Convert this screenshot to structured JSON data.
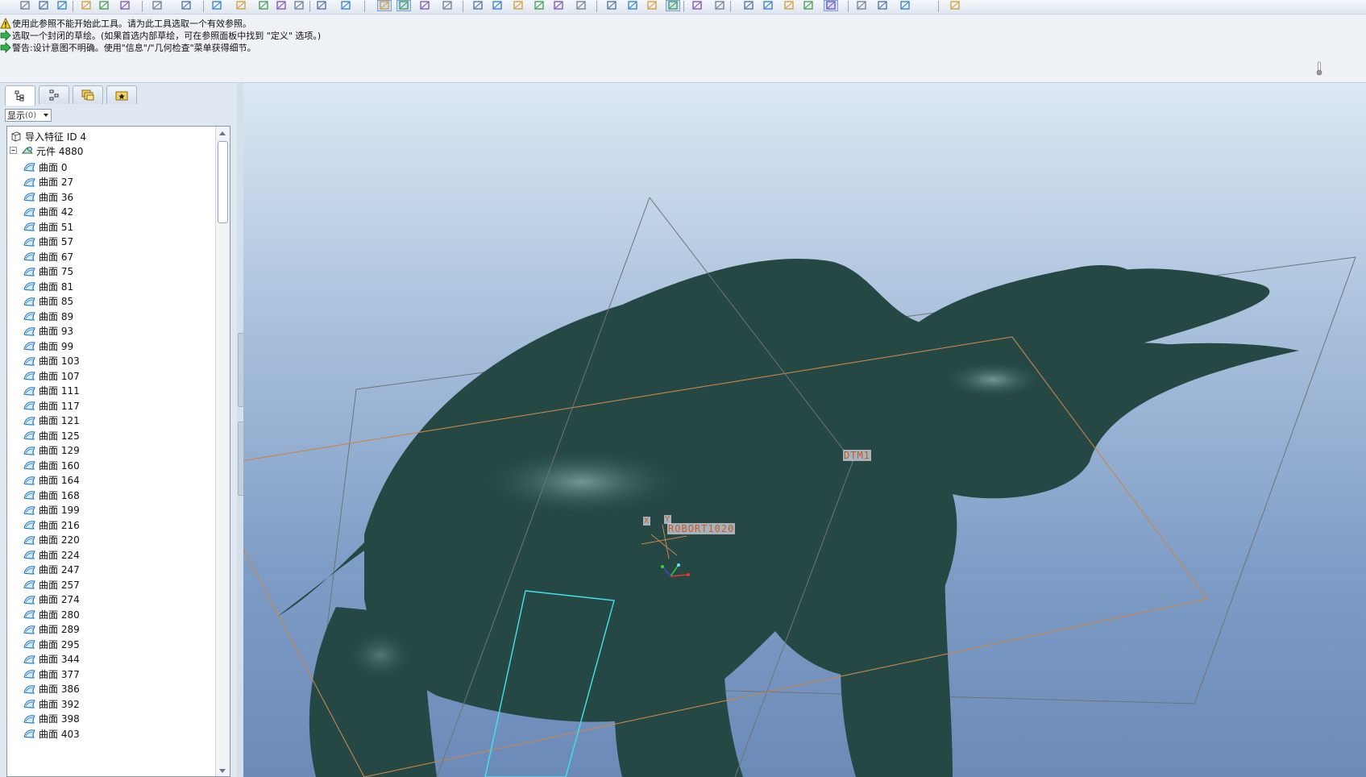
{
  "messages": [
    {
      "type": "warning",
      "text": "使用此参照不能开始此工具。请为此工具选取一个有效参照。"
    },
    {
      "type": "prompt",
      "text": "选取一个封闭的草绘。(如果首选内部草绘，可在参照面板中找到 \"定义\" 选项。)"
    },
    {
      "type": "prompt",
      "text": "警告:设计意图不明确。使用\"信息\"/\"几何检查\"菜单获得细节。"
    }
  ],
  "panel": {
    "show_label": "显示",
    "show_badge": "(0)",
    "tree": {
      "root_label": "导入特征 ID 4",
      "group_label": "元件 4880",
      "items": [
        "曲面 0",
        "曲面 27",
        "曲面 36",
        "曲面 42",
        "曲面 51",
        "曲面 57",
        "曲面 67",
        "曲面 75",
        "曲面 81",
        "曲面 85",
        "曲面 89",
        "曲面 93",
        "曲面 99",
        "曲面 103",
        "曲面 107",
        "曲面 111",
        "曲面 117",
        "曲面 121",
        "曲面 125",
        "曲面 129",
        "曲面 160",
        "曲面 164",
        "曲面 168",
        "曲面 199",
        "曲面 216",
        "曲面 220",
        "曲面 224",
        "曲面 247",
        "曲面 257",
        "曲面 274",
        "曲面 280",
        "曲面 289",
        "曲面 295",
        "曲面 344",
        "曲面 377",
        "曲面 386",
        "曲面 392",
        "曲面 398",
        "曲面 403"
      ]
    }
  },
  "viewport": {
    "datum_label": "DTM1",
    "csys_label": "ROBORT1020",
    "csys_x": "X",
    "csys_y": "Y",
    "colors": {
      "model": "#254845",
      "datum_orange": "#c9864a",
      "datum_gray": "#6f7378",
      "sketch_cyan": "#3fe3e8"
    }
  },
  "toolbar": {
    "icons": [
      "new-icon",
      "open-icon",
      "save-icon",
      "print-icon",
      "send-icon",
      "copy-file-icon",
      "undo-icon",
      "redo-icon",
      "cut-icon",
      "copy-icon",
      "paste-icon",
      "paste-special-icon",
      "regenerate-icon",
      "find-icon",
      "select-box-icon",
      "sketch-icon",
      "datum-curve-icon",
      "csys-toggle-icon",
      "shading-icon",
      "zoom-in-icon",
      "zoom-out-icon",
      "refit-icon",
      "reorient-icon",
      "saved-views-icon",
      "layer-icon",
      "wireframe-icon",
      "hidden-line-icon",
      "no-hidden-icon",
      "shading-mode-icon",
      "enhanced-realism-icon",
      "view-manager-icon",
      "datum-plane-display-icon",
      "datum-axis-display-icon",
      "datum-point-display-icon",
      "csys-display-icon",
      "annotation-display-icon",
      "pen-icon",
      "sketch-tool-icon",
      "datum-plane-icon",
      "help-icon"
    ]
  }
}
